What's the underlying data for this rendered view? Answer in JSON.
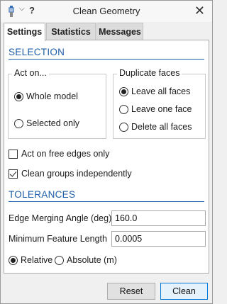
{
  "window": {
    "title": "Clean Geometry"
  },
  "tabs": [
    {
      "label": "Settings"
    },
    {
      "label": "Statistics"
    },
    {
      "label": "Messages"
    }
  ],
  "selection": {
    "header": "SELECTION",
    "act_on": {
      "title": "Act on...",
      "options": [
        {
          "label": "Whole model",
          "selected": true
        },
        {
          "label": "Selected only",
          "selected": false
        }
      ]
    },
    "duplicate_faces": {
      "title": "Duplicate faces",
      "options": [
        {
          "label": "Leave all faces",
          "selected": true
        },
        {
          "label": "Leave one face",
          "selected": false
        },
        {
          "label": "Delete all faces",
          "selected": false
        }
      ]
    },
    "free_edges_only": {
      "label": "Act on free edges only",
      "checked": false
    },
    "clean_groups_independently": {
      "label": "Clean groups independently",
      "checked": true
    }
  },
  "tolerances": {
    "header": "TOLERANCES",
    "edge_merging_angle": {
      "label": "Edge Merging Angle (deg)",
      "value": "160.0"
    },
    "min_feature_length": {
      "label": "Minimum Feature Length",
      "value": "0.0005"
    },
    "mode": [
      {
        "label": "Relative",
        "selected": true
      },
      {
        "label": "Absolute (m)",
        "selected": false
      }
    ]
  },
  "buttons": {
    "reset": "Reset",
    "clean": "Clean"
  }
}
